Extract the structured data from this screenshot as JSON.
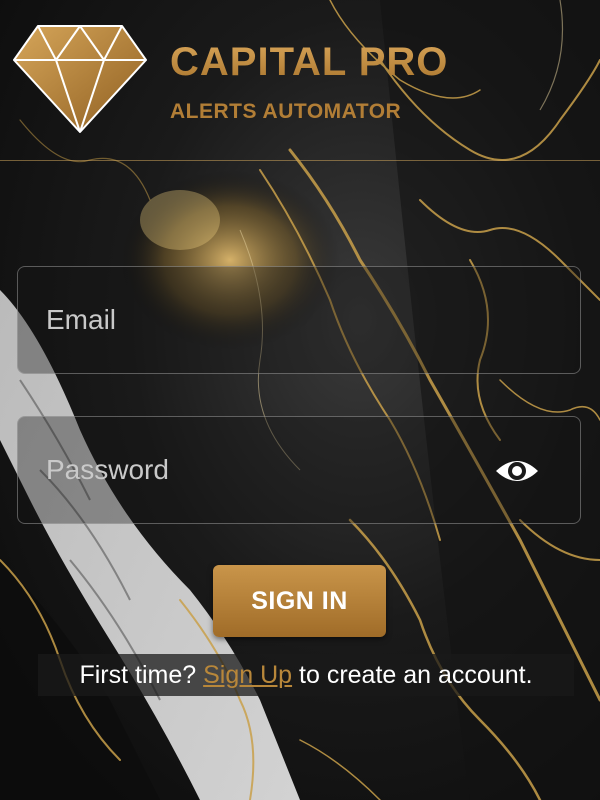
{
  "app": {
    "title": "CAPITAL PRO",
    "subtitle": "ALERTS AUTOMATOR",
    "logo_icon": "diamond-icon",
    "accent_color": "#b8873a"
  },
  "form": {
    "email_placeholder": "Email",
    "email_value": "",
    "password_placeholder": "Password",
    "password_value": "",
    "password_toggle_icon": "eye-icon",
    "signin_label": "SIGN IN"
  },
  "footer": {
    "prefix": "First time?",
    "link_label": "Sign Up",
    "suffix": "to create an account."
  }
}
